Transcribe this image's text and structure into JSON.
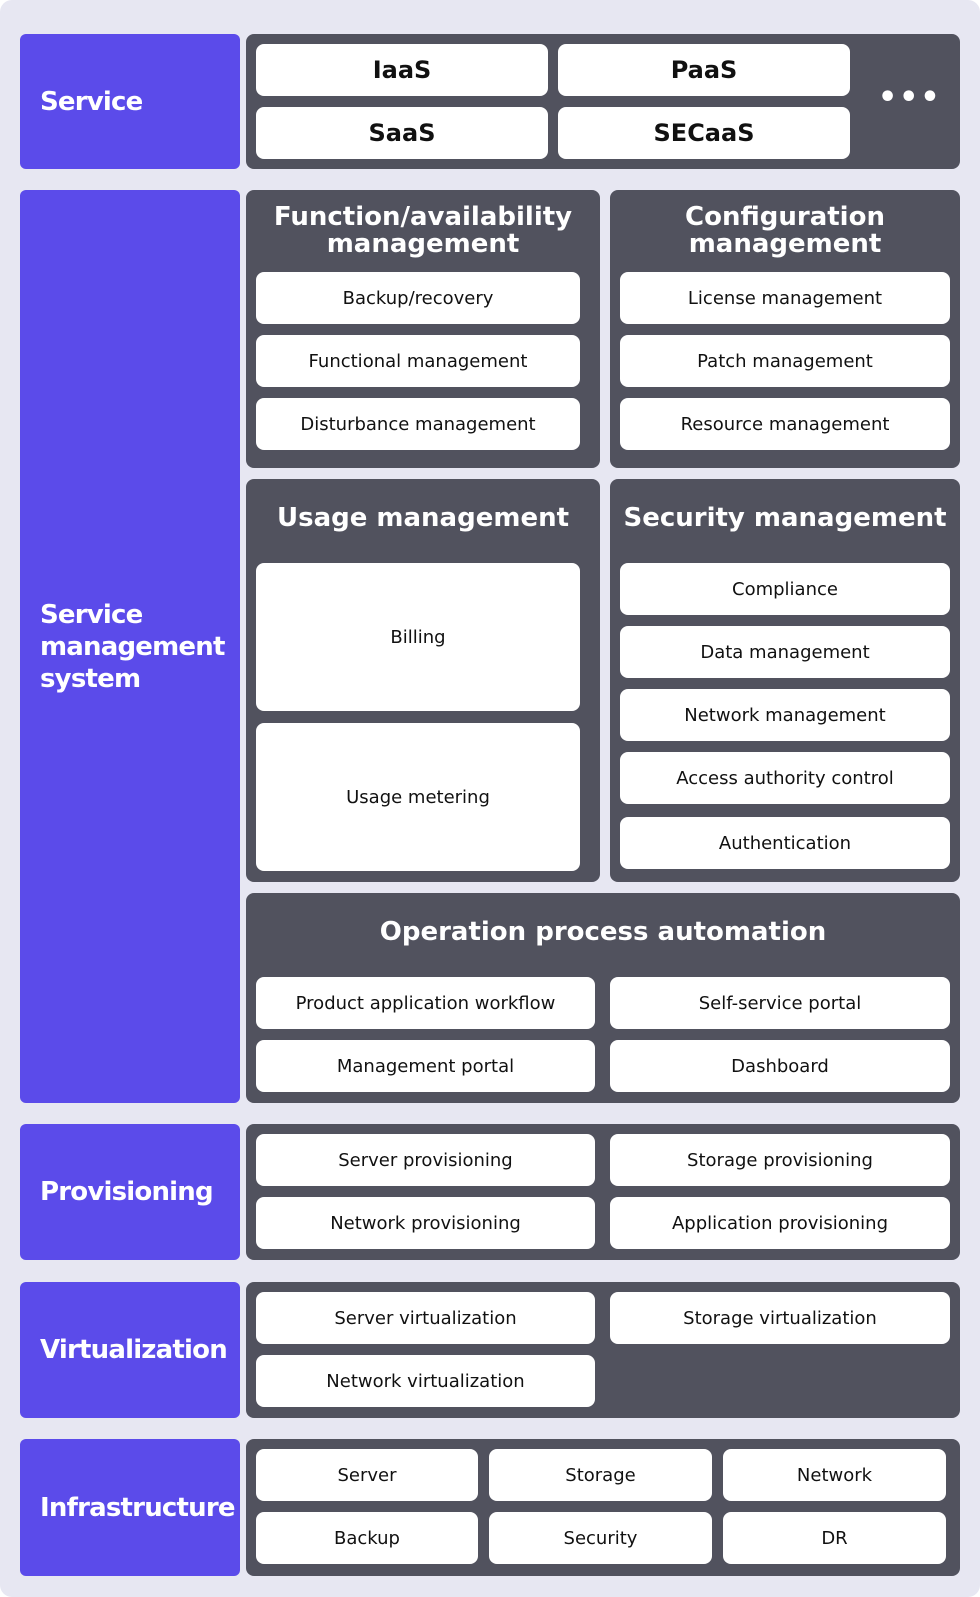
{
  "service": {
    "label": "Service",
    "items": [
      "IaaS",
      "PaaS",
      "SaaS",
      "SECaaS"
    ],
    "more_label": "•••"
  },
  "service_management": {
    "label": "Service management system",
    "function_availability": {
      "title": "Function/availability management",
      "items": [
        "Backup/recovery",
        "Functional management",
        "Disturbance management"
      ]
    },
    "configuration": {
      "title": "Configuration management",
      "items": [
        "License management",
        "Patch management",
        "Resource management"
      ]
    },
    "usage": {
      "title": "Usage management",
      "items": [
        "Billing",
        "Usage metering"
      ]
    },
    "security": {
      "title": "Security management",
      "items": [
        "Compliance",
        "Data management",
        "Network management",
        "Access authority control",
        "Authentication"
      ]
    },
    "operation": {
      "title": "Operation process automation",
      "items": [
        "Product application workflow",
        "Self-service portal",
        "Management portal",
        "Dashboard"
      ]
    }
  },
  "provisioning": {
    "label": "Provisioning",
    "items": [
      "Server provisioning",
      "Storage provisioning",
      "Network provisioning",
      "Application provisioning"
    ]
  },
  "virtualization": {
    "label": "Virtualization",
    "items": [
      "Server virtualization",
      "Storage virtualization",
      "Network virtualization"
    ]
  },
  "infrastructure": {
    "label": "Infrastructure",
    "items": [
      "Server",
      "Storage",
      "Network",
      "Backup",
      "Security",
      "DR"
    ]
  },
  "colors": {
    "background": "#e7e7f2",
    "label_panel": "#5b4bea",
    "content_panel": "#51525e",
    "card": "#ffffff"
  }
}
